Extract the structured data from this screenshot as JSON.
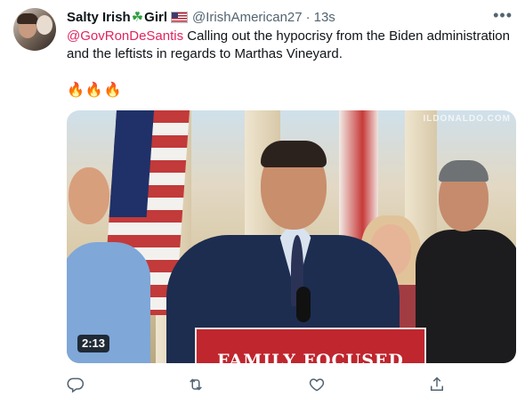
{
  "tweet": {
    "display_name": "Salty Irish",
    "name_emoji": "☘",
    "name_suffix": "Girl",
    "handle": "@IrishAmerican27",
    "separator": "·",
    "time": "13s",
    "more_glyph": "•••",
    "mention": "@GovRonDeSantis",
    "text": " Calling out the hypocrisy from the Biden administration and the leftists in regards to Marthas Vineyard.",
    "emojis": "🔥🔥🔥"
  },
  "media": {
    "watermark": "ILDONALDO.COM",
    "podium_text": "FAMILY FOCUSED",
    "duration": "2:13"
  },
  "actions": {
    "reply_icon": "reply-icon",
    "retweet_icon": "retweet-icon",
    "like_icon": "like-icon",
    "share_icon": "share-icon"
  },
  "colors": {
    "mention": "#e0245e",
    "secondary_text": "#536471",
    "primary_text": "#0f1419"
  }
}
